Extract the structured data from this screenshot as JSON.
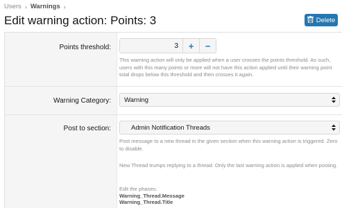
{
  "breadcrumb": {
    "items": [
      "Users",
      "Warnings"
    ],
    "sep": "›"
  },
  "page": {
    "title": "Edit warning action: Points: 3"
  },
  "actions": {
    "delete_label": "Delete"
  },
  "colors": {
    "accent": "#2577b1",
    "label_bg": "#f5f5f5",
    "help_text": "#8c8c8c"
  },
  "form": {
    "points_threshold": {
      "label": "Points threshold:",
      "value": "3",
      "plus": "+",
      "minus": "−",
      "help": "This warning action will only be applied when a user crosses the points threshold. As such, users with this many points or more will not have this action applied until their warning point total drops below this threshold and then crosses it again."
    },
    "warning_category": {
      "label": "Warning Category:",
      "selected": "Warning"
    },
    "post_to_section": {
      "label": "Post to section:",
      "selected": "Admin Notification Threads",
      "help1": "Post message to a new thread in the given section when this warning action is triggered. Zero to disable.",
      "help2": "New Thread trumps replying to a thread. Only the last warning action is applied when posting.",
      "phases_intro": "Edit the phases:",
      "phases": [
        "Warning_Thread.Message",
        "Warning_Thread.Title"
      ]
    }
  },
  "icons": {
    "delete": "trash-icon",
    "select": "select-arrows-icon"
  }
}
